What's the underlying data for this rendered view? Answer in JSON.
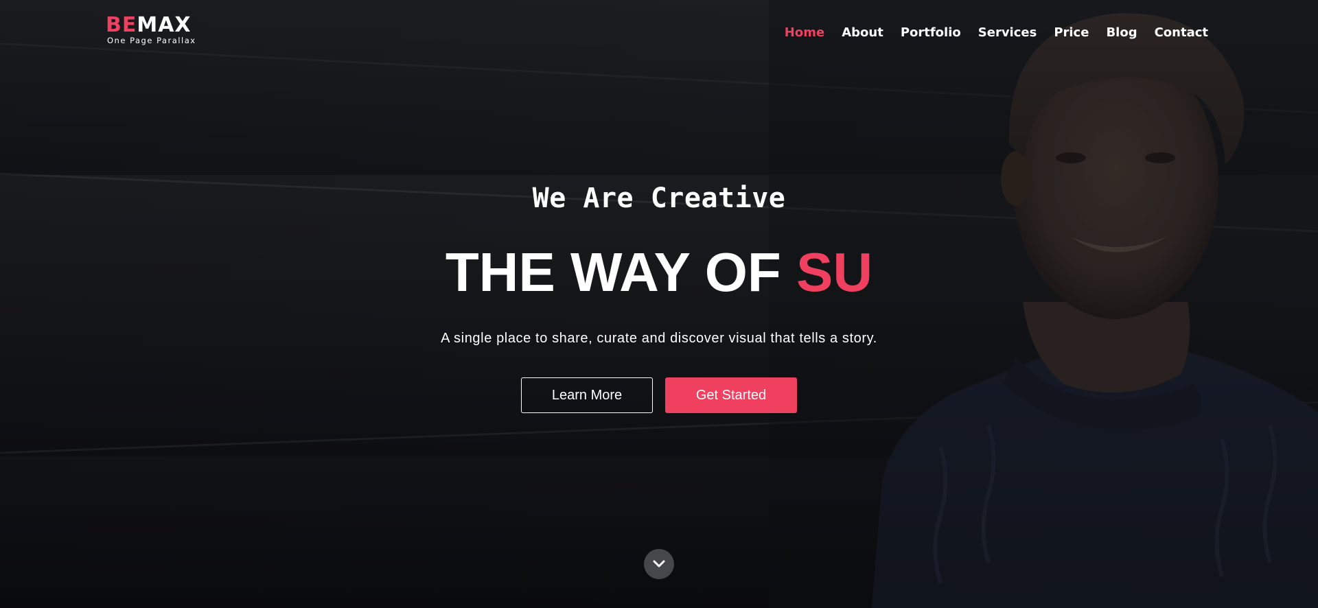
{
  "brand": {
    "logo_accent": "BE",
    "logo_rest": "MAX",
    "tagline": "One Page Parallax",
    "accent_color": "#ef4060"
  },
  "nav": {
    "items": [
      {
        "label": "Home",
        "active": true
      },
      {
        "label": "About",
        "active": false
      },
      {
        "label": "Portfolio",
        "active": false
      },
      {
        "label": "Services",
        "active": false
      },
      {
        "label": "Price",
        "active": false
      },
      {
        "label": "Blog",
        "active": false
      },
      {
        "label": "Contact",
        "active": false
      }
    ]
  },
  "hero": {
    "eyebrow": "We Are Creative",
    "headline_main": "THE WAY OF ",
    "headline_accent": "SU",
    "subtext": "A single place to share, curate and discover visual that tells a story.",
    "learn_more_label": "Learn More",
    "get_started_label": "Get Started",
    "scroll_icon": "chevron-down-icon"
  }
}
